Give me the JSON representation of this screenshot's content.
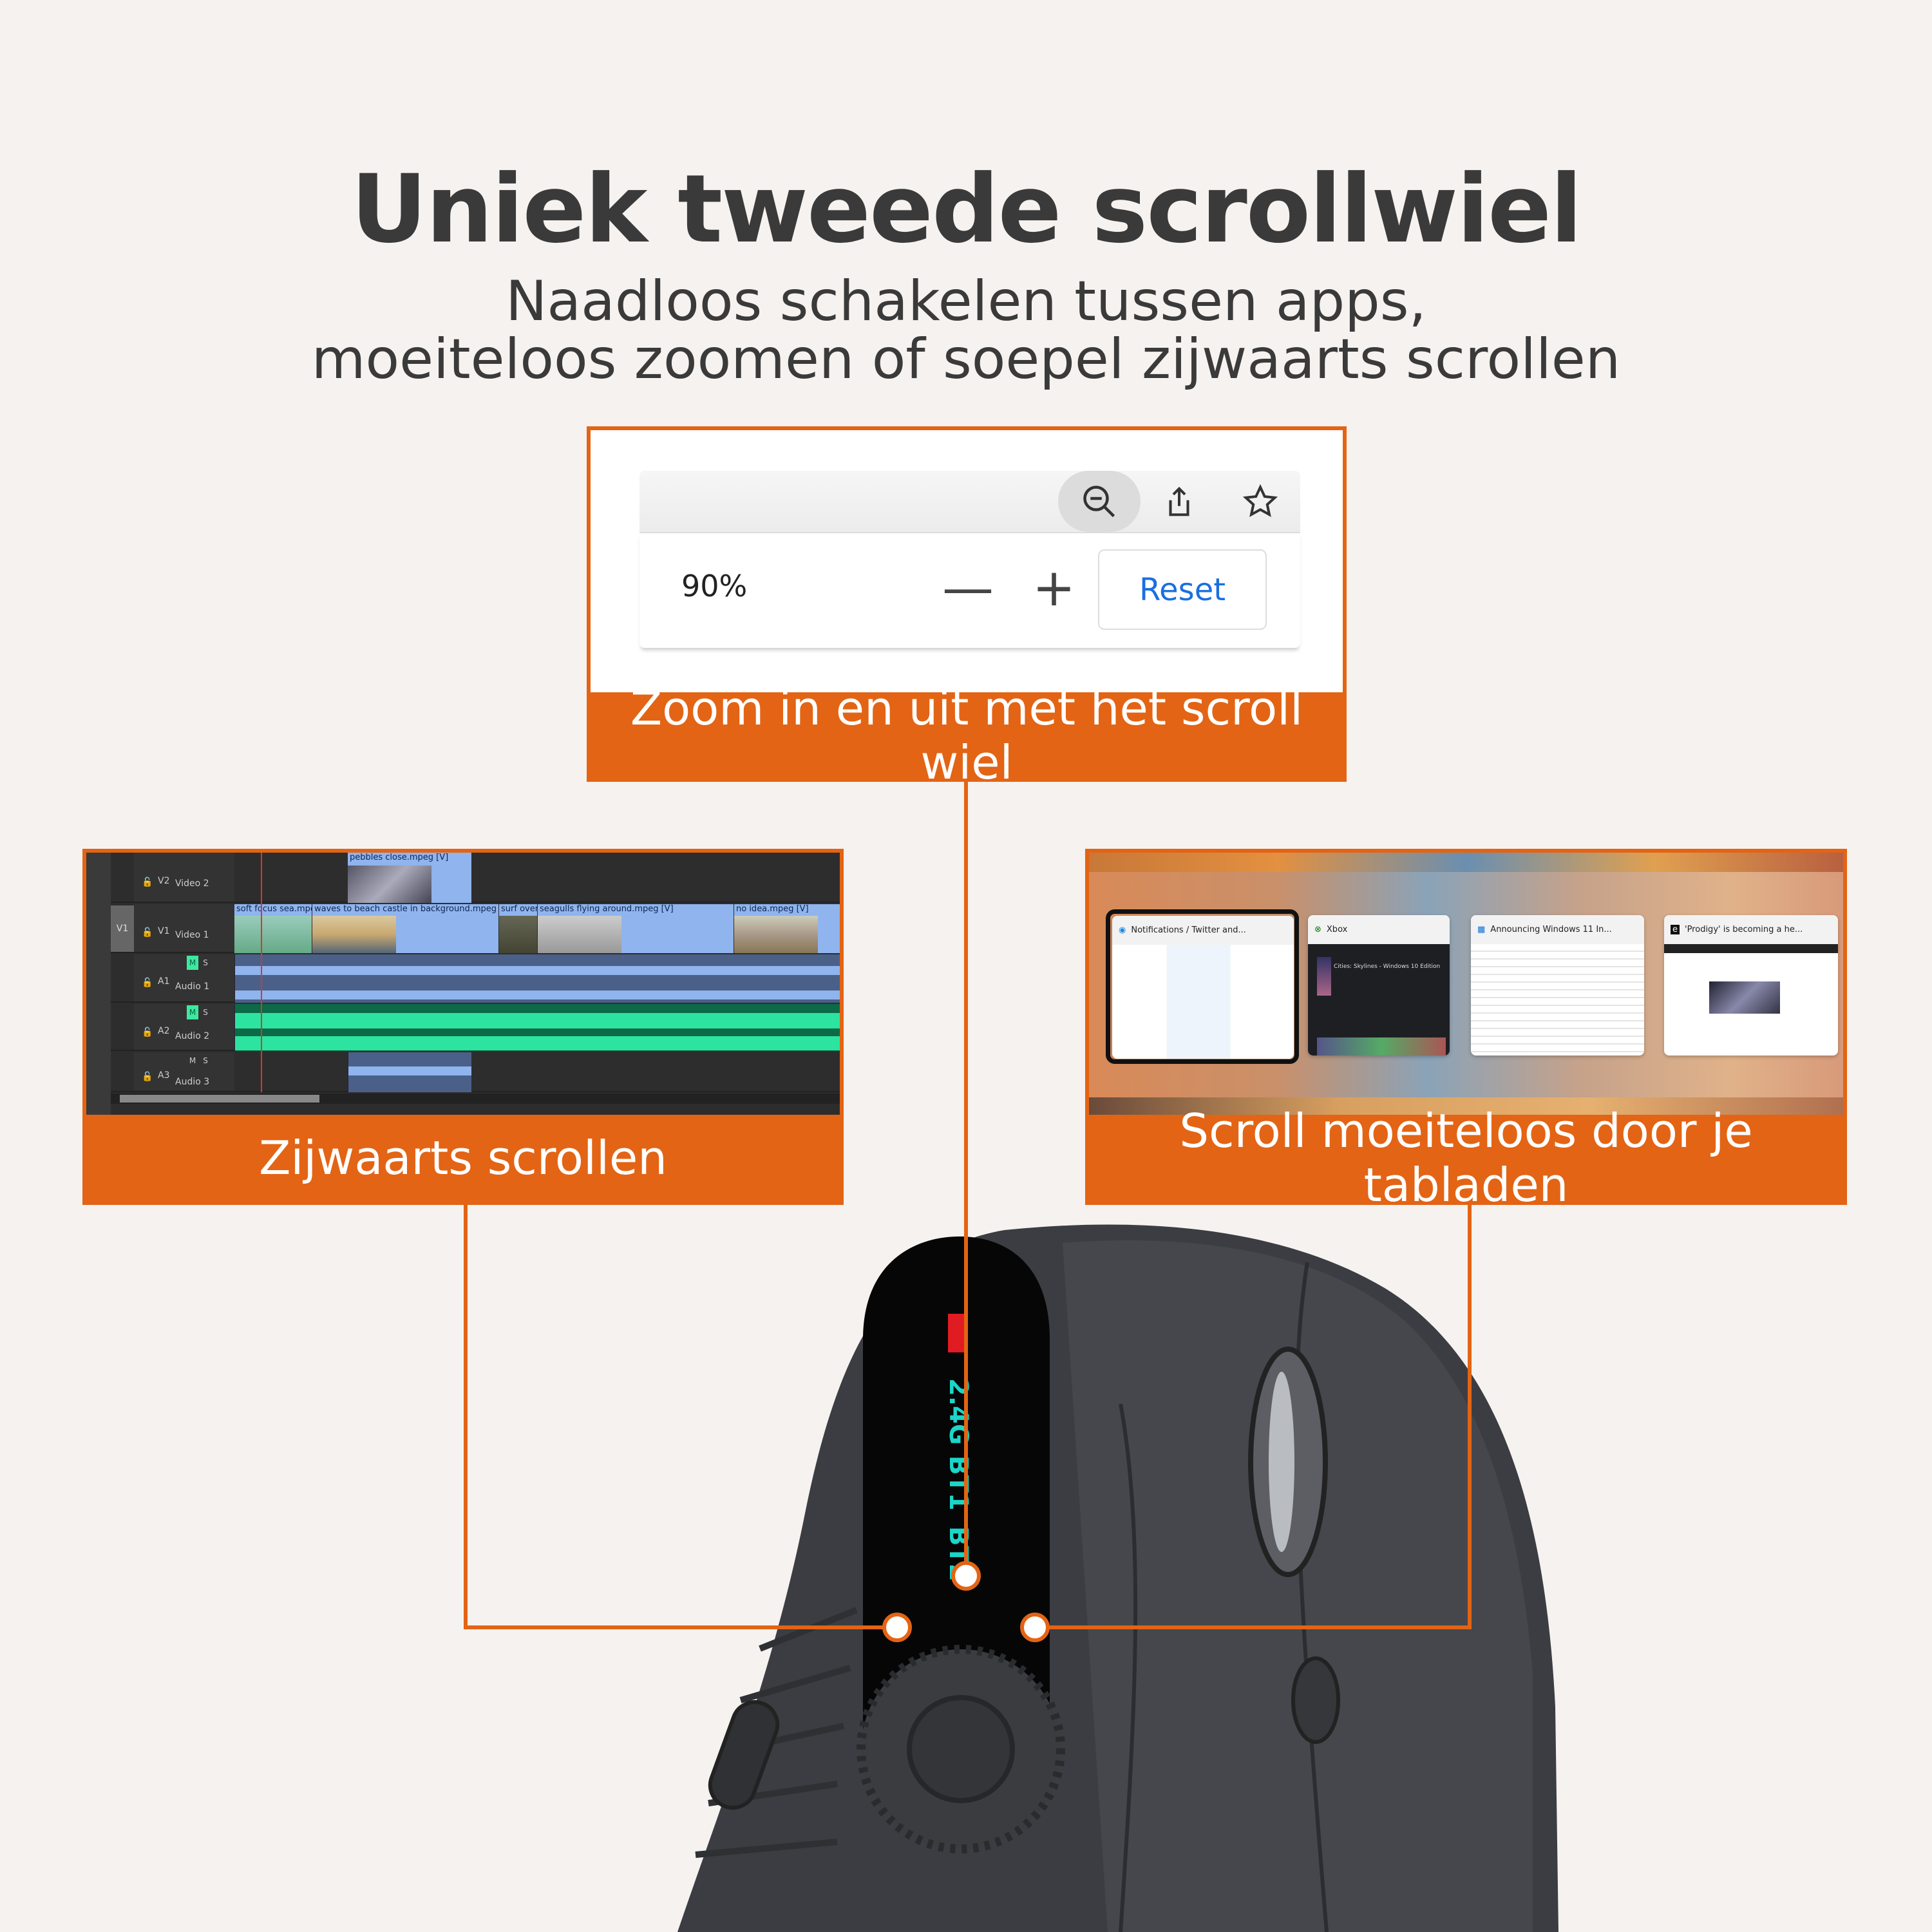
{
  "header": {
    "title": "Uniek tweede scrollwiel",
    "subtitle_lines": [
      "Naadloos schakelen tussen apps,",
      "moeiteloos zoomen of soepel zijwaarts scrollen"
    ]
  },
  "accent_color": "#E36414",
  "zoom_panel": {
    "zoom_level": "90%",
    "minus": "—",
    "plus": "+",
    "reset": "Reset",
    "caption": "Zoom in en uit met het scroll wiel",
    "icons": [
      "zoom-out-icon",
      "share-icon",
      "star-icon"
    ]
  },
  "editor_panel": {
    "caption": "Zijwaarts scrollen",
    "tracks": [
      {
        "id": "V2",
        "name": "Video 2"
      },
      {
        "id": "V1",
        "name": "Video 1",
        "target": "V1"
      },
      {
        "id": "A1",
        "name": "Audio 1"
      },
      {
        "id": "A2",
        "name": "Audio 2"
      },
      {
        "id": "A3",
        "name": "Audio 3"
      }
    ],
    "clips": [
      "pebbles close.mpeg [V]",
      "soft focus sea.mpe",
      "waves to beach castle in background.mpeg [V]",
      "surf over",
      "seagulls flying around.mpeg [V]",
      "no idea.mpeg [V]"
    ],
    "mute": "M",
    "solo": "S"
  },
  "tabs_panel": {
    "caption": "Scroll moeiteloos door je tabladen",
    "tabs": [
      {
        "title": "Notifications / Twitter and...",
        "icon": "edge-icon"
      },
      {
        "title": "Xbox",
        "icon": "xbox-icon"
      },
      {
        "title": "Announcing Windows 11 In...",
        "icon": "windows-icon"
      },
      {
        "title": "'Prodigy' is becoming a he...",
        "icon": "engadget-icon"
      }
    ],
    "xbox_game": "Cities: Skylines - Windows 10 Edition"
  },
  "mouse": {
    "indicators": [
      "2.4G",
      "BT1",
      "BT2"
    ]
  }
}
